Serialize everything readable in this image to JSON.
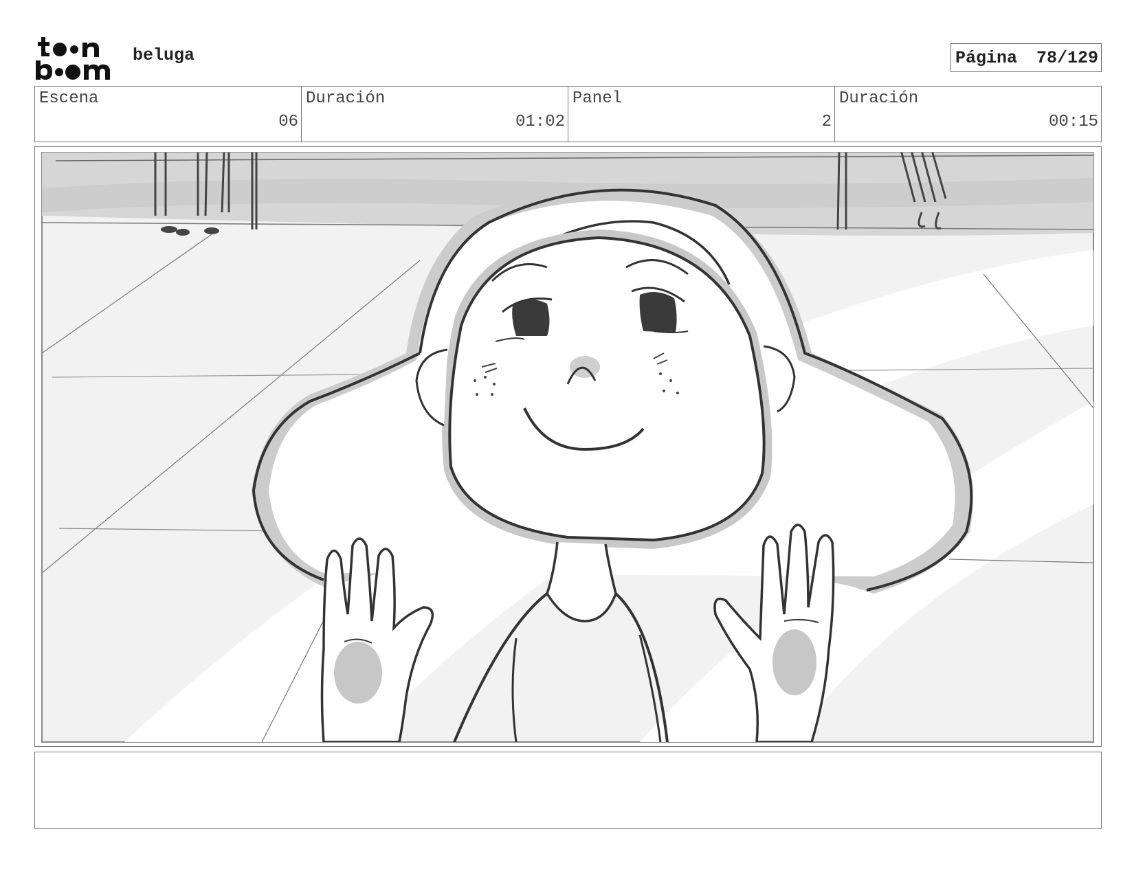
{
  "header": {
    "logo_text": "toon boom",
    "project": "beluga",
    "page_label": "Página",
    "page_number": "78/129"
  },
  "info": [
    {
      "label": "Escena",
      "value": "06"
    },
    {
      "label": "Duración",
      "value": "01:02"
    },
    {
      "label": "Panel",
      "value": "2"
    },
    {
      "label": "Duración",
      "value": "00:15"
    }
  ],
  "panel": {
    "description": "",
    "notes": ""
  }
}
